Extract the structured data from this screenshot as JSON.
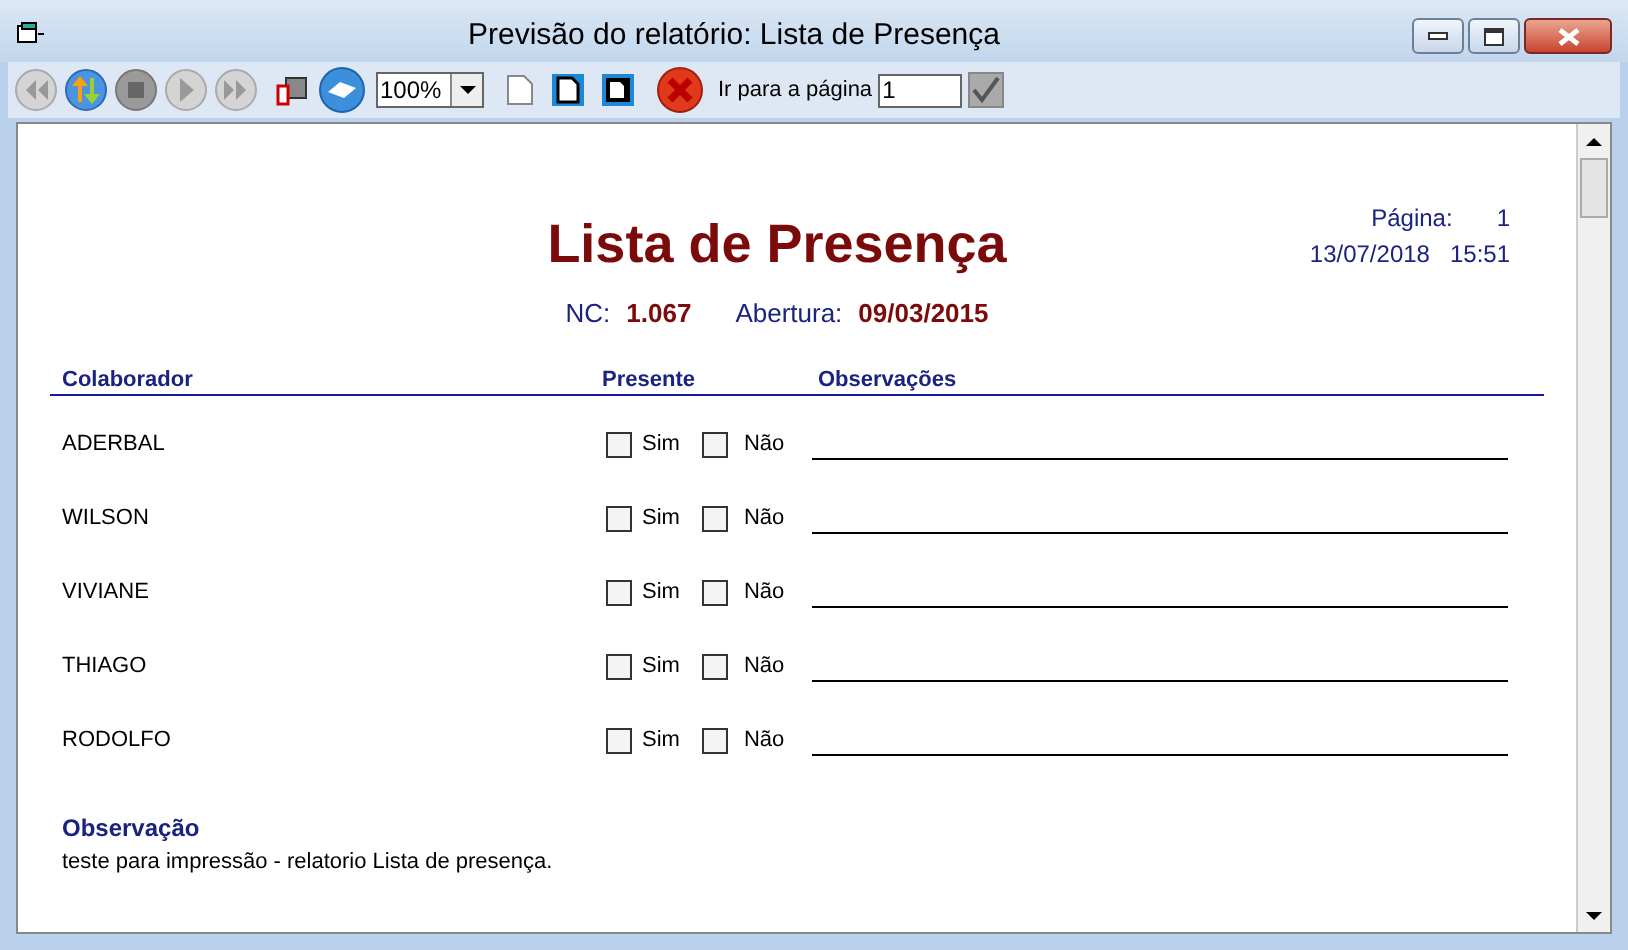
{
  "window": {
    "title": "Previsão do relatório: Lista de Presença"
  },
  "toolbar": {
    "zoom": "100%",
    "goto_label": "Ir para a página",
    "page_value": "1"
  },
  "report": {
    "title": "Lista de Presença",
    "page_label": "Página:",
    "page_number": "1",
    "date": "13/07/2018",
    "time": "15:51",
    "nc_label": "NC:",
    "nc_value": "1.067",
    "abertura_label": "Abertura:",
    "abertura_value": "09/03/2015",
    "columns": [
      "Colaborador",
      "Presente",
      "Observações"
    ],
    "rows": [
      {
        "name": "ADERBAL",
        "sim_label": "Sim",
        "sim_checked": false,
        "nao_label": "Não",
        "nao_checked": false
      },
      {
        "name": "WILSON",
        "sim_label": "Sim",
        "sim_checked": false,
        "nao_label": "Não",
        "nao_checked": false
      },
      {
        "name": "VIVIANE",
        "sim_label": "Sim",
        "sim_checked": false,
        "nao_label": "Não",
        "nao_checked": false
      },
      {
        "name": "THIAGO",
        "sim_label": "Sim",
        "sim_checked": false,
        "nao_label": "Não",
        "nao_checked": false
      },
      {
        "name": "RODOLFO",
        "sim_label": "Sim",
        "sim_checked": false,
        "nao_label": "Não",
        "nao_checked": false
      }
    ],
    "note_title": "Observação",
    "note_text": "teste para impressão - relatorio Lista de presença."
  }
}
